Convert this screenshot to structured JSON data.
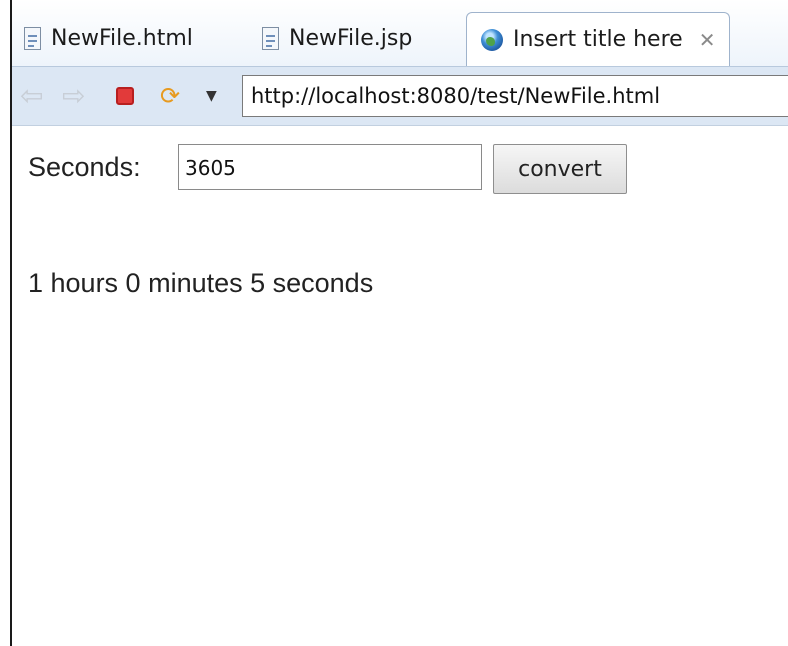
{
  "tabs": [
    {
      "label": "NewFile.html",
      "icon": "html-file-icon"
    },
    {
      "label": "NewFile.jsp",
      "icon": "jsp-file-icon"
    },
    {
      "label": "Insert title here",
      "icon": "globe-icon",
      "active": true
    }
  ],
  "toolbar": {
    "url": "http://localhost:8080/test/NewFile.html"
  },
  "form": {
    "label": "Seconds:",
    "value": "3605",
    "button_label": "convert"
  },
  "result": "1 hours 0 minutes 5 seconds",
  "colors": {
    "toolbar_bg": "#dce7f4",
    "stop_red": "#e23a3a",
    "refresh_orange": "#e79a20"
  }
}
